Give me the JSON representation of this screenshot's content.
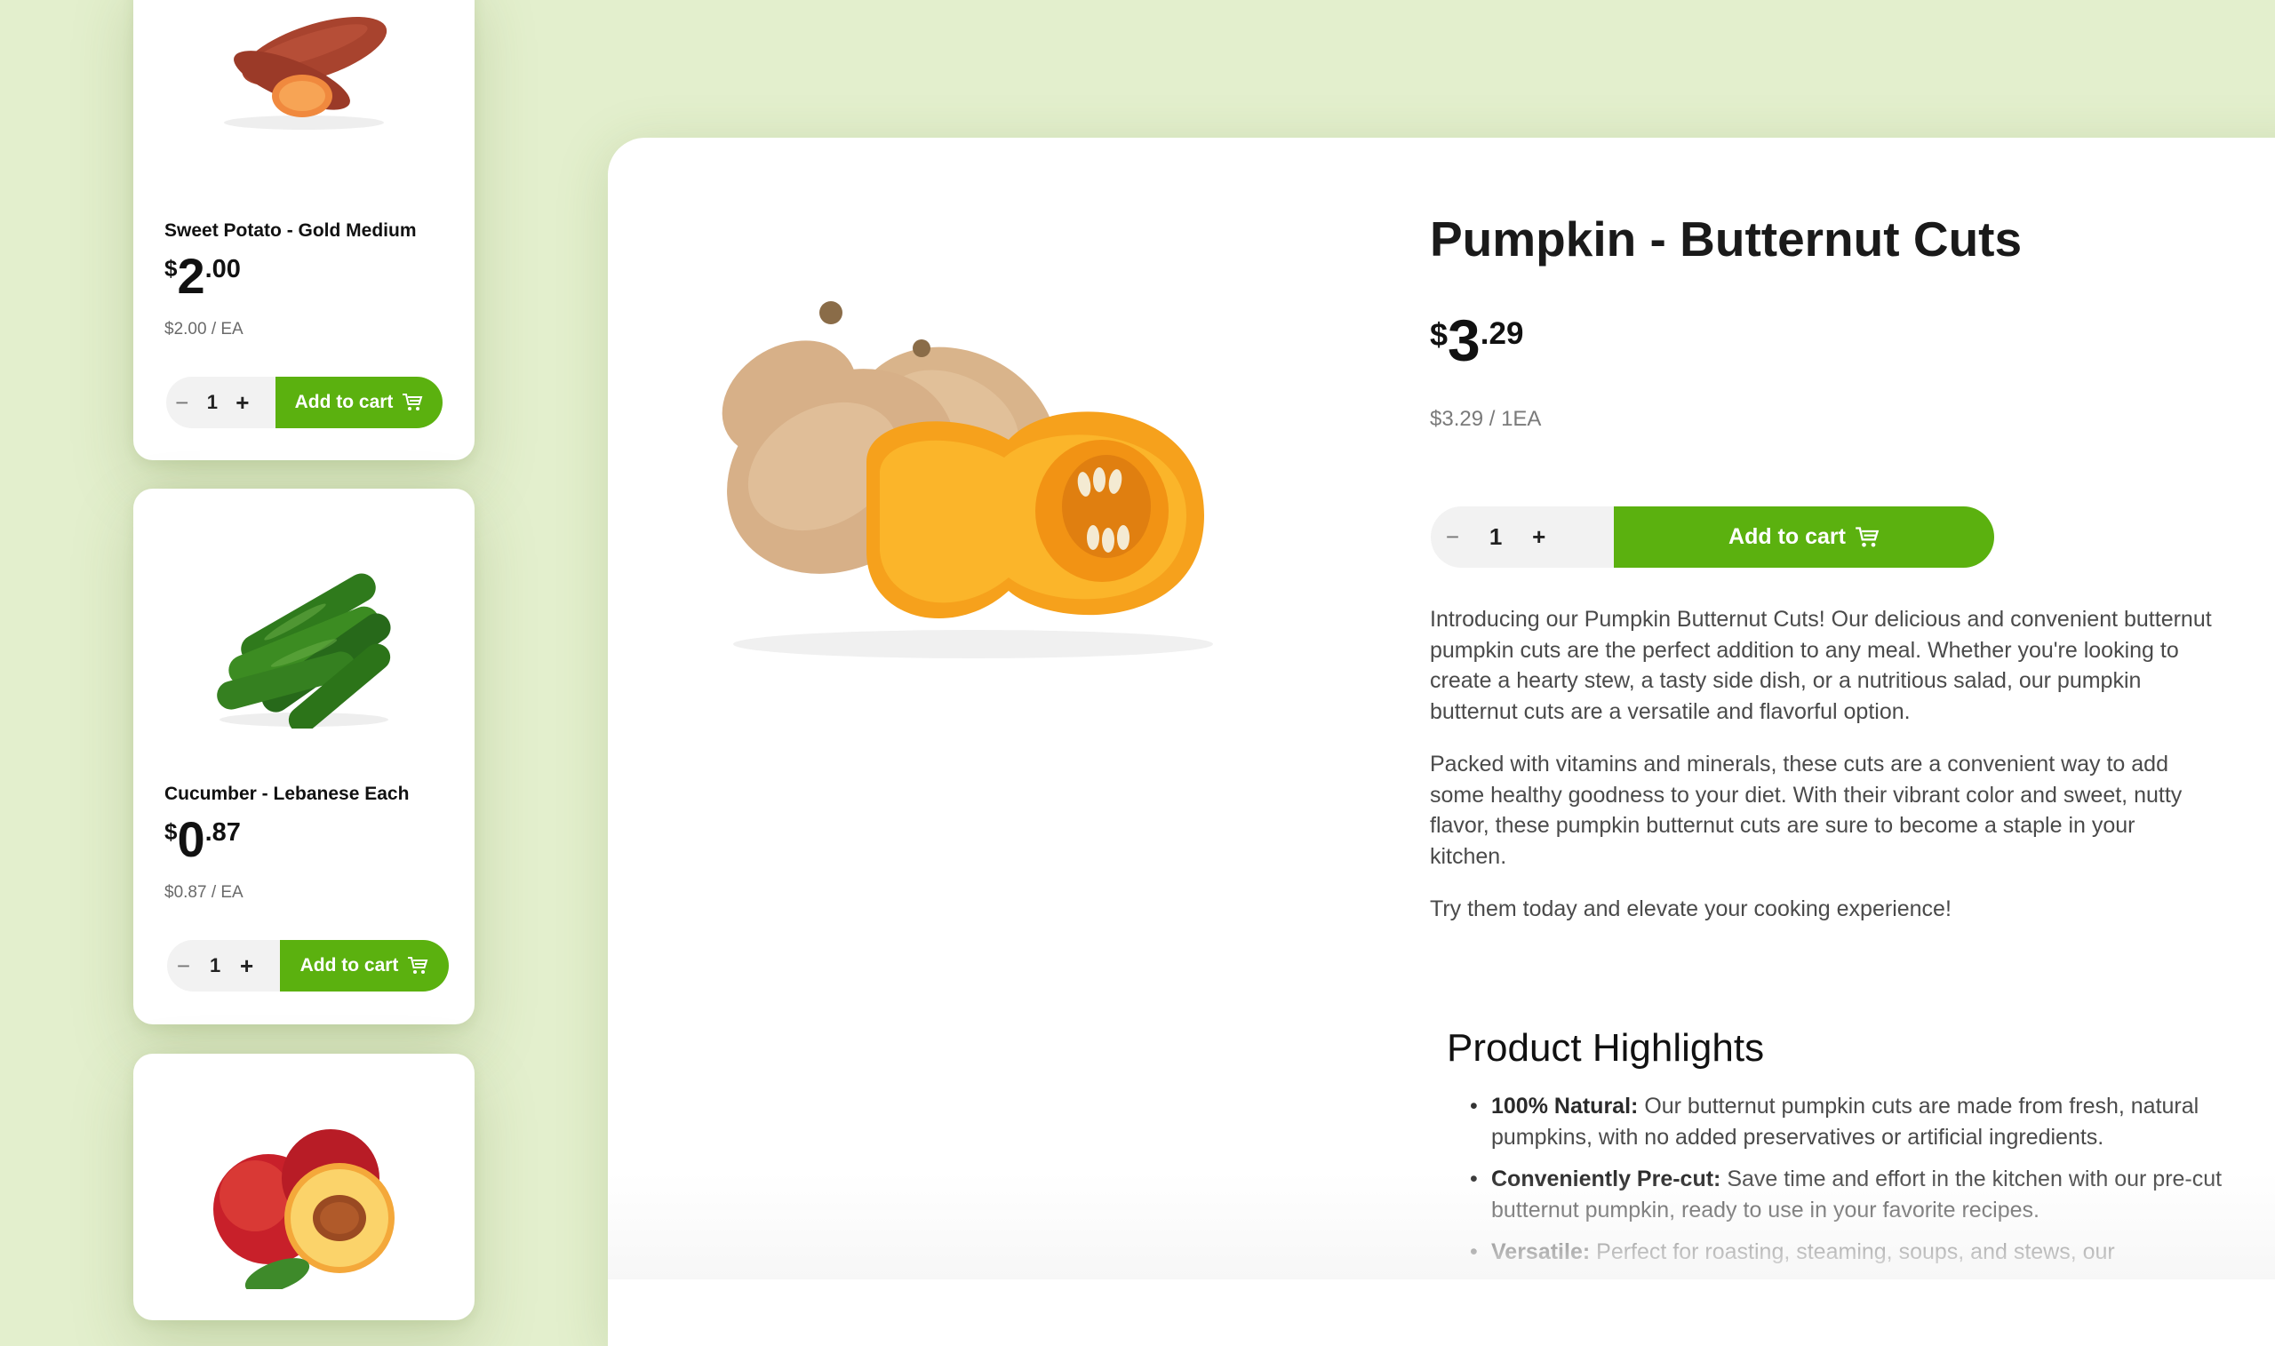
{
  "sidebar_products": [
    {
      "name": "Sweet Potato - Gold Medium",
      "price_symbol": "$",
      "price_dollars": "2",
      "price_cents": ".00",
      "unit_price": "$2.00 / EA",
      "quantity": "1",
      "add_to_cart_label": "Add to cart"
    },
    {
      "name": "Cucumber - Lebanese Each",
      "price_symbol": "$",
      "price_dollars": "0",
      "price_cents": ".87",
      "unit_price": "$0.87 / EA",
      "quantity": "1",
      "add_to_cart_label": "Add to cart"
    },
    {
      "name": "",
      "image": "peach"
    }
  ],
  "product": {
    "title": "Pumpkin - Butternut Cuts",
    "price_symbol": "$",
    "price_dollars": "3",
    "price_cents": ".29",
    "unit_price": "$3.29 / 1EA",
    "quantity": "1",
    "add_to_cart_label": "Add to cart",
    "description": [
      "Introducing our Pumpkin Butternut Cuts! Our delicious and convenient butternut pumpkin cuts are the perfect addition to any meal. Whether you're looking to create a hearty stew, a tasty side dish, or a nutritious salad, our pumpkin butternut cuts are a versatile and flavorful option.",
      "Packed with vitamins and minerals, these cuts are a convenient way to add some healthy goodness to your diet. With their vibrant color and sweet, nutty flavor, these pumpkin butternut cuts are sure to become a staple in your kitchen.",
      "Try them today and elevate your cooking experience!"
    ],
    "highlights_title": "Product Highlights",
    "highlights": [
      {
        "label": "100% Natural:",
        "text": "Our butternut pumpkin cuts are made from fresh, natural pumpkins, with no added preservatives or artificial ingredients."
      },
      {
        "label": "Conveniently Pre-cut:",
        "text": "Save time and effort in the kitchen with our pre-cut butternut pumpkin, ready to use in your favorite recipes."
      },
      {
        "label": "Versatile:",
        "text": "Perfect for roasting, steaming, soups, and stews, our"
      }
    ]
  },
  "colors": {
    "background": "#e3efcd",
    "accent_green": "#5bb10f",
    "card": "#ffffff"
  },
  "icons": [
    "cart-icon",
    "minus-icon",
    "plus-icon"
  ]
}
